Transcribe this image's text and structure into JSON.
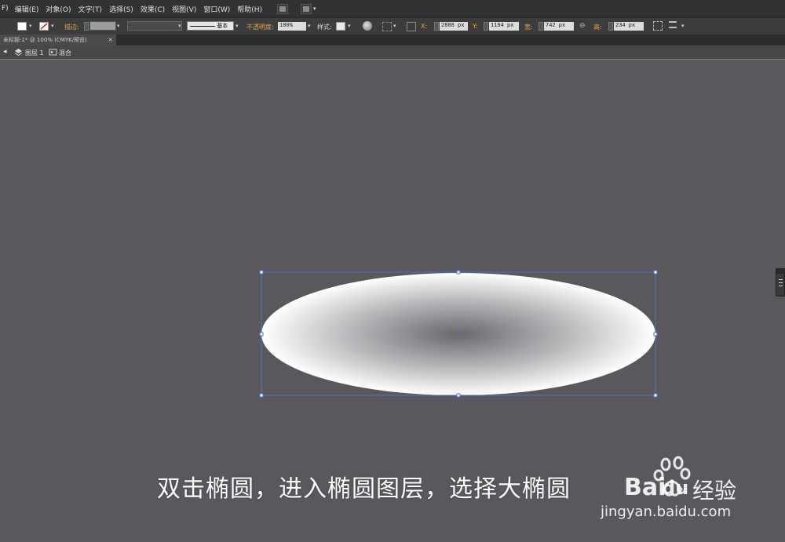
{
  "menu": {
    "items": [
      "F)",
      "编辑(E)",
      "对象(O)",
      "文字(T)",
      "选择(S)",
      "效果(C)",
      "视图(V)",
      "窗口(W)",
      "帮助(H)"
    ]
  },
  "control_bar": {
    "stroke_label": "描边:",
    "stroke_style": "基本",
    "opacity_label": "不透明度:",
    "opacity_value": "100%",
    "style_label": "样式:",
    "x_label": "X:",
    "x_value": "2888 px",
    "y_label": "Y:",
    "y_value": "1104 px",
    "w_label": "宽:",
    "w_value": "742 px",
    "h_label": "高:",
    "h_value": "234 px"
  },
  "document_tab": {
    "title": "未标题-1* @ 100% (CMYK/预览)",
    "close": "×"
  },
  "breadcrumb": {
    "layer": "图层 1",
    "group": "混合"
  },
  "canvas": {
    "background": "#5a585c",
    "selection_color": "#4a73c8",
    "ellipse_center_color": "#6a686c",
    "ellipse_edge_color": "#ffffff"
  },
  "caption": {
    "text": "双击椭圆，进入椭圆图层，选择大椭圆"
  },
  "watermark": {
    "brand": "Bai",
    "brand_du": "du",
    "product": "经验",
    "url": "jingyan.baidu.com"
  },
  "icons": {
    "layers": "layers-icon",
    "back": "back-arrow-icon",
    "group": "group-icon"
  }
}
